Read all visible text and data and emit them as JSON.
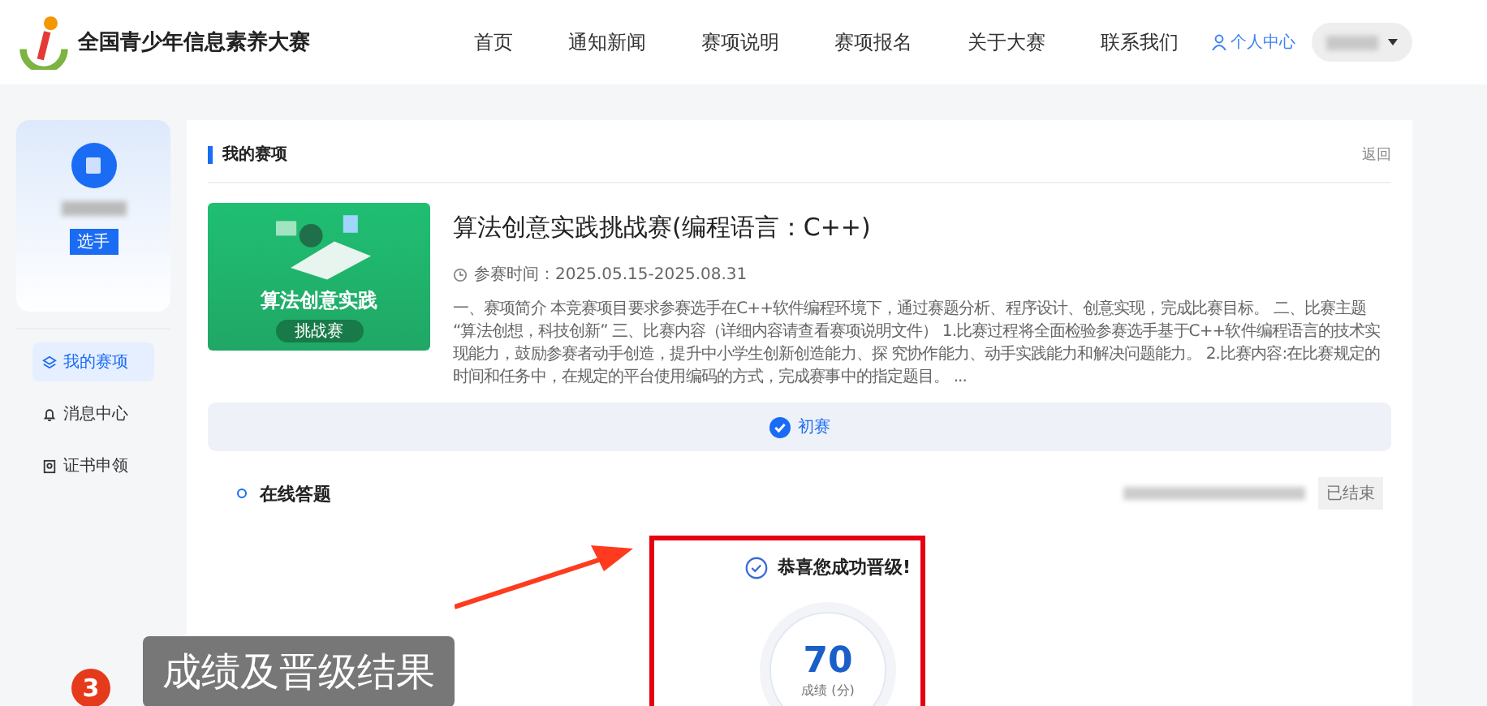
{
  "header": {
    "site_title": "全国青少年信息素养大赛",
    "nav": [
      {
        "label": "首页",
        "selected": false
      },
      {
        "label": "通知新闻",
        "selected": false
      },
      {
        "label": "赛项说明",
        "selected": false
      },
      {
        "label": "赛项报名",
        "selected": false
      },
      {
        "label": "关于大赛",
        "selected": false
      },
      {
        "label": "联系我们",
        "selected": false
      }
    ],
    "user_center": "个人中心"
  },
  "sidebar": {
    "role_badge": "选手",
    "items": [
      {
        "label": "我的赛项",
        "selected": true
      },
      {
        "label": "消息中心",
        "selected": false
      },
      {
        "label": "证书申领",
        "selected": false
      }
    ]
  },
  "section": {
    "title": "我的赛项",
    "back_link": "返回"
  },
  "competition": {
    "banner_title": "算法创意实践",
    "banner_badge": "挑战赛",
    "title": "算法创意实践挑战赛(编程语言：C++)",
    "time": "参赛时间：2025.05.15-2025.08.31",
    "description": "一、赛项简介 本竞赛项目要求参赛选手在C++软件编程环境下，通过赛题分析、程序设计、创意实现，完成比赛目标。 二、比赛主题 “算法创想，科技创新” 三、比赛内容（详细内容请查看赛项说明文件） 1.比赛过程将全面检验参赛选手基于C++软件编程语言的技术实现能力，鼓励参赛者动手创造，提升中小学生创新创造能力、探 究协作能力、动手实践能力和解决问题能力。 2.比赛内容:在比赛规定的时间和任务中，在规定的平台使用编码的方式，完成赛事中的指定题目。 ..."
  },
  "stages": [
    {
      "label": "初赛",
      "selected": true
    }
  ],
  "task": {
    "name": "在线答题",
    "status": "已结束"
  },
  "result": {
    "message": "恭喜您成功晋级!",
    "score": "70",
    "score_label": "成绩 (分)"
  },
  "annotation": {
    "number": "3",
    "text": "成绩及晋级结果"
  }
}
